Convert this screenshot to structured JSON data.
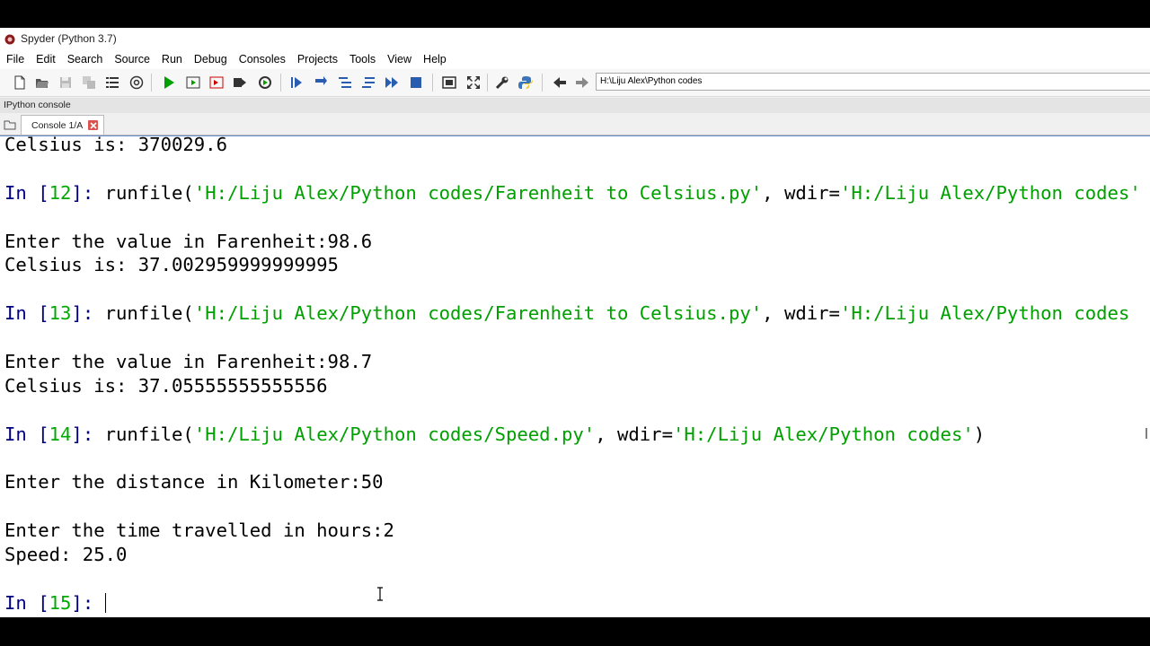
{
  "window": {
    "title": "Spyder (Python 3.7)"
  },
  "menu": [
    "File",
    "Edit",
    "Search",
    "Source",
    "Run",
    "Debug",
    "Consoles",
    "Projects",
    "Tools",
    "View",
    "Help"
  ],
  "toolbar": {
    "path_value": "H:\\Liju Alex\\Python codes",
    "buttons": [
      "new-file",
      "open-file",
      "save-file",
      "save-all",
      "outline",
      "at-symbol",
      "run-file",
      "run-cell",
      "run-cell-advance",
      "run-selection",
      "rerun",
      "debug",
      "step",
      "step-into",
      "step-return",
      "continue",
      "stop-debug",
      "maximize-pane",
      "fullscreen",
      "preferences",
      "python-path",
      "back",
      "forward"
    ]
  },
  "pane": {
    "title": "IPython console"
  },
  "tabs": [
    {
      "label": "Console 1/A"
    }
  ],
  "console": {
    "l1": "Celsius is: 370029.6",
    "p12_word": "In [",
    "p12_num": "12",
    "p12_close": "]: ",
    "p12_call": "runfile(",
    "p12_str1": "'H:/Liju Alex/Python codes/Farenheit to Celsius.py'",
    "p12_mid": ", wdir=",
    "p12_str2": "'H:/Liju Alex/Python codes'",
    "l4": "Enter the value in Farenheit:98.6",
    "l5": "Celsius is: 37.002959999999995",
    "p13_word": "In [",
    "p13_num": "13",
    "p13_close": "]: ",
    "p13_call": "runfile(",
    "p13_str1": "'H:/Liju Alex/Python codes/Farenheit to Celsius.py'",
    "p13_mid": ", wdir=",
    "p13_str2": "'H:/Liju Alex/Python codes",
    "l9": "Enter the value in Farenheit:98.7",
    "l10": "Celsius is: 37.05555555555556",
    "p14_word": "In [",
    "p14_num": "14",
    "p14_close": "]: ",
    "p14_call": "runfile(",
    "p14_str1": "'H:/Liju Alex/Python codes/Speed.py'",
    "p14_mid": ", wdir=",
    "p14_str2": "'H:/Liju Alex/Python codes'",
    "p14_end": ")",
    "l13": "Enter the distance in Kilometer:50",
    "l15": "Enter the time travelled in hours:2",
    "l16": "Speed: 25.0",
    "p15_word": "In [",
    "p15_num": "15",
    "p15_close": "]: "
  },
  "colors": {
    "prompt": "#000080",
    "prompt_number": "#00aa00",
    "string": "#00a000",
    "run": "#00a000",
    "stop": "#2a5db0"
  }
}
